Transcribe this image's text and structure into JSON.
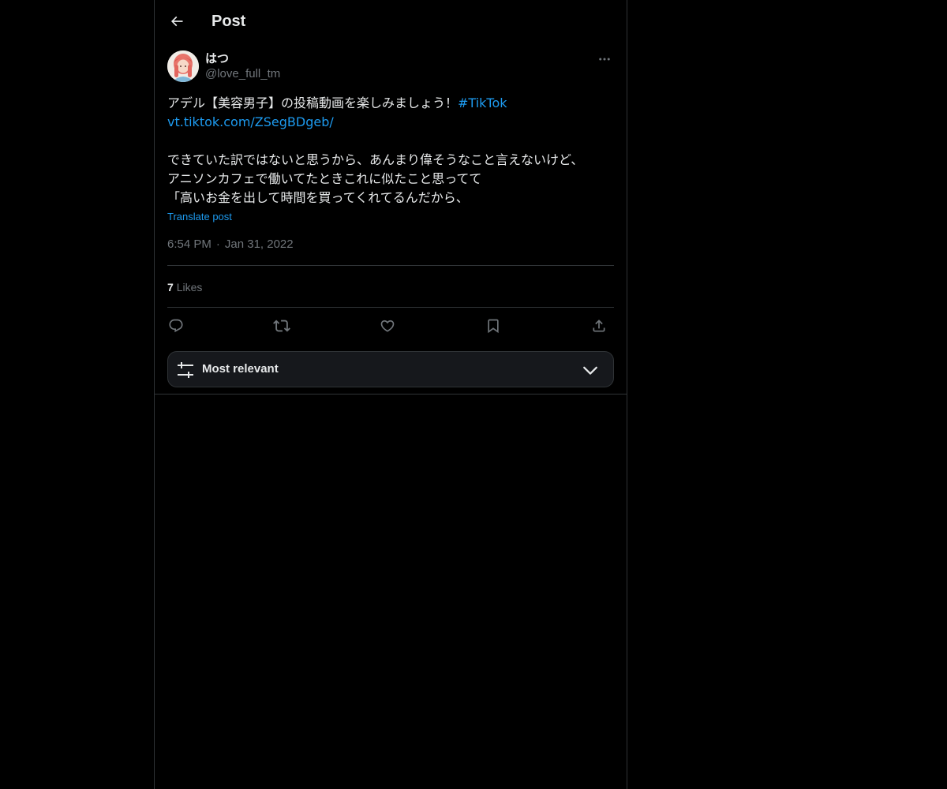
{
  "header": {
    "back_icon": "arrow-left-icon",
    "title": "Post"
  },
  "post": {
    "author": {
      "display_name": "はつ",
      "handle": "@love_full_tm"
    },
    "more_icon": "more-horizontal-icon",
    "text": {
      "line1_text": "アデル【美容男子】の投稿動画を楽しみましょう！",
      "line1_hashtag": "#TikTok",
      "line2_link": "vt.tiktok.com/ZSegBDgeb/",
      "line3": "できていた訳ではないと思うから、あんまり偉そうなこと言えないけど、",
      "line4": "アニソンカフェで働いてたときこれに似たこと思ってて",
      "line5": "「高いお金を出して時間を買ってくれてるんだから、"
    },
    "translate_label": "Translate post",
    "time": "6:54 PM",
    "date": "Jan 31, 2022",
    "likes_count": "7",
    "likes_label": "Likes",
    "actions": {
      "reply_icon": "reply-icon",
      "repost_icon": "repost-icon",
      "like_icon": "heart-icon",
      "bookmark_icon": "bookmark-icon",
      "share_icon": "share-icon"
    }
  },
  "sort": {
    "icon": "sliders-icon",
    "label": "Most relevant",
    "chevron": "chevron-down-icon"
  },
  "colors": {
    "background": "#000000",
    "text": "#e7e9ea",
    "muted": "#71767b",
    "accent": "#1d9bf0",
    "border": "#2f3336"
  }
}
